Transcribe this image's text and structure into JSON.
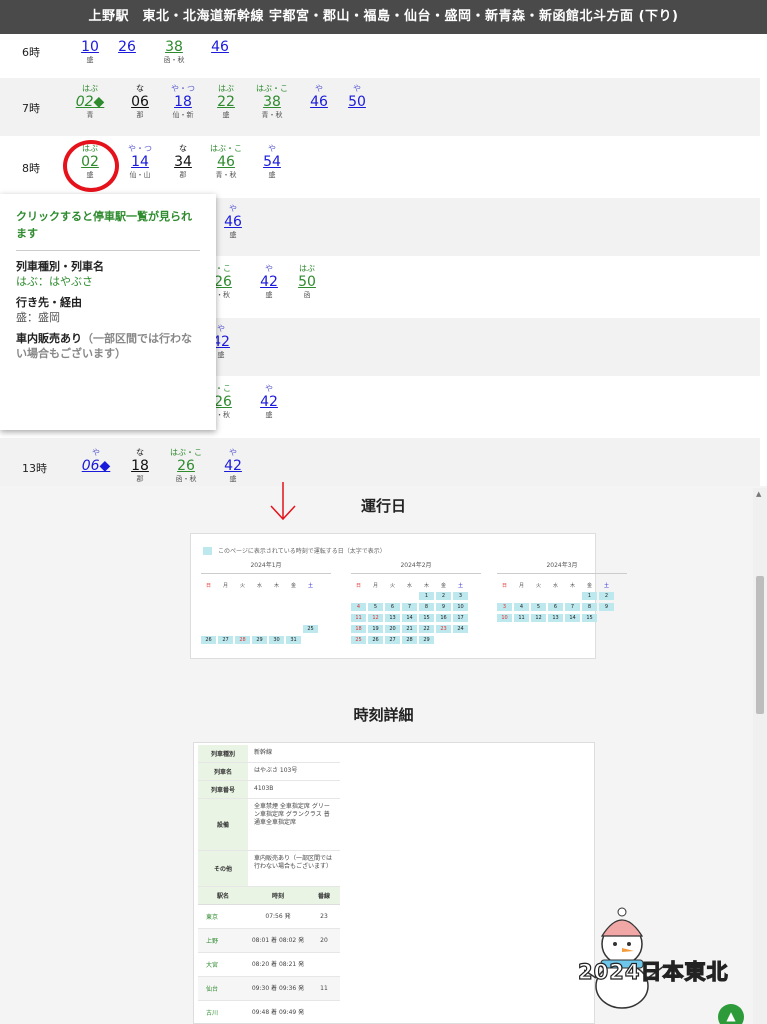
{
  "header": {
    "title": "上野駅　東北・北海道新幹線 宇都宮・郡山・福島・仙台・盛岡・新青森・新函館北斗方面 (下り)"
  },
  "rows": [
    {
      "hour": "6時",
      "trains": [
        {
          "top": "",
          "num": "10",
          "bot": "盛",
          "color": "blue"
        },
        {
          "top": "",
          "num": "26",
          "bot": "",
          "color": "blue"
        },
        {
          "top": "",
          "num": "38",
          "bot": "函・秋",
          "color": "green"
        },
        {
          "top": "",
          "num": "46",
          "bot": "",
          "color": "blue"
        }
      ]
    },
    {
      "hour": "7時",
      "trains": [
        {
          "top": "はぶ",
          "num": "02◆",
          "bot": "青",
          "color": "green",
          "italic": true
        },
        {
          "top": "な",
          "num": "06",
          "bot": "那",
          "color": "black"
        },
        {
          "top": "や・つ",
          "num": "18",
          "bot": "仙・新",
          "color": "blue"
        },
        {
          "top": "はぶ",
          "num": "22",
          "bot": "盛",
          "color": "green"
        },
        {
          "top": "はぶ・こ",
          "num": "38",
          "bot": "青・秋",
          "color": "green"
        },
        {
          "top": "や",
          "num": "46",
          "bot": "",
          "color": "blue"
        },
        {
          "top": "や",
          "num": "50",
          "bot": "",
          "color": "blue"
        }
      ]
    },
    {
      "hour": "8時",
      "trains": [
        {
          "top": "はぶ",
          "num": "02",
          "bot": "盛",
          "color": "green"
        },
        {
          "top": "や・つ",
          "num": "14",
          "bot": "仙・山",
          "color": "blue"
        },
        {
          "top": "な",
          "num": "34",
          "bot": "郡",
          "color": "black"
        },
        {
          "top": "はぶ・こ",
          "num": "46",
          "bot": "青・秋",
          "color": "green"
        },
        {
          "top": "や",
          "num": "54",
          "bot": "盛",
          "color": "blue"
        }
      ]
    },
    {
      "hour": "",
      "trains": [
        {
          "top": "や",
          "num": "46",
          "bot": "盛",
          "color": "blue"
        }
      ]
    },
    {
      "hour": "",
      "trains": [
        {
          "top": "・こ",
          "num": "26",
          "bot": "・秋",
          "color": "green"
        },
        {
          "top": "や",
          "num": "42",
          "bot": "盛",
          "color": "blue"
        },
        {
          "top": "はぶ",
          "num": "50",
          "bot": "函",
          "color": "green"
        }
      ]
    },
    {
      "hour": "",
      "trains": [
        {
          "top": "や",
          "num": "42",
          "bot": "盛",
          "color": "blue"
        }
      ]
    },
    {
      "hour": "",
      "trains": [
        {
          "top": "・こ",
          "num": "26",
          "bot": "・秋",
          "color": "green"
        },
        {
          "top": "や",
          "num": "42",
          "bot": "盛",
          "color": "blue"
        }
      ]
    },
    {
      "hour": "13時",
      "trains": [
        {
          "top": "や",
          "num": "06◆",
          "bot": "",
          "color": "blue",
          "italic": true
        },
        {
          "top": "な",
          "num": "18",
          "bot": "郡",
          "color": "black"
        },
        {
          "top": "はぶ・こ",
          "num": "26",
          "bot": "函・秋",
          "color": "green"
        },
        {
          "top": "や",
          "num": "42",
          "bot": "盛",
          "color": "blue"
        }
      ]
    }
  ],
  "tooltip": {
    "hint": "クリックすると停車駅一覧が見られます",
    "type_label": "列車種別・列車名",
    "type_value": "はぶ：はやぶさ",
    "dest_label": "行き先・経由",
    "dest_value": "盛：盛岡",
    "sales_label": "車内販売あり",
    "sales_note": "（一部区間では行わない場合もございます）"
  },
  "running_days": {
    "title": "運行日",
    "legend": "このページに表示されている時刻で運転する日（太字で表示）",
    "weekdays": [
      "日",
      "月",
      "火",
      "水",
      "木",
      "金",
      "土"
    ],
    "months": [
      {
        "name": "2024年1月",
        "lead": 3,
        "count": 31,
        "on": [
          25,
          26,
          27,
          28,
          29,
          30,
          31
        ],
        "red": [
          28
        ]
      },
      {
        "name": "2024年2月",
        "lead": 4,
        "count": 29,
        "on": [
          1,
          2,
          3,
          4,
          5,
          6,
          7,
          8,
          9,
          10,
          11,
          12,
          13,
          14,
          15,
          16,
          17,
          18,
          19,
          20,
          21,
          22,
          23,
          24,
          25,
          26,
          27,
          28,
          29
        ],
        "red": [
          4,
          11,
          12,
          18,
          23,
          25
        ]
      },
      {
        "name": "2024年3月",
        "lead": 5,
        "count": 15,
        "on": [
          1,
          2,
          3,
          4,
          5,
          6,
          7,
          8,
          9,
          10,
          11,
          12,
          13,
          14,
          15
        ],
        "red": [
          3,
          10
        ]
      }
    ]
  },
  "detail": {
    "title": "時刻詳細",
    "info": [
      {
        "k": "列車種別",
        "v": "新幹線"
      },
      {
        "k": "列車名",
        "v": "はやぶさ 103号"
      },
      {
        "k": "列車番号",
        "v": "4103B"
      },
      {
        "k": "設備",
        "v": "全車禁煙 全車指定席 グリーン車指定席 グランクラス 普通車全車指定席"
      },
      {
        "k": "その他",
        "v": "車内販売あり（一部区間では行わない場合もございます）"
      }
    ],
    "headers": [
      "駅名",
      "時刻",
      "番線"
    ],
    "stations": [
      {
        "n": "東京",
        "t": "07:56 発",
        "p": "23"
      },
      {
        "n": "上野",
        "t": "08:01 着 08:02 発",
        "p": "20"
      },
      {
        "n": "大宮",
        "t": "08:20 着 08:21 発",
        "p": ""
      },
      {
        "n": "仙台",
        "t": "09:30 着 09:36 発",
        "p": "11"
      },
      {
        "n": "古川",
        "t": "09:48 着 09:49 発",
        "p": ""
      }
    ]
  },
  "watermark": "2024日本東北"
}
